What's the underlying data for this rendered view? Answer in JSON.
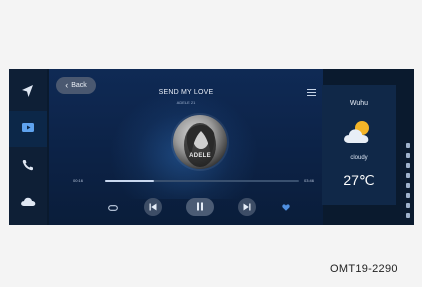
{
  "nav": {
    "back_label": "Back"
  },
  "sidebar": {
    "items": [
      {
        "icon": "navigation-arrow-icon"
      },
      {
        "icon": "media-icon"
      },
      {
        "icon": "phone-icon"
      },
      {
        "icon": "cloud-icon"
      }
    ]
  },
  "player": {
    "song_title": "SEND MY LOVE",
    "artist": "ADELE 21",
    "album_label": "ADELE",
    "elapsed": "00:16",
    "duration": "03:46",
    "progress_fraction": 0.25,
    "controls": {
      "repeat_icon": "repeat-icon",
      "prev_icon": "previous-track-icon",
      "play_icon": "pause-icon",
      "next_icon": "next-track-icon",
      "favorite_icon": "heart-icon"
    }
  },
  "weather": {
    "city": "Wuhu",
    "condition": "cloudy",
    "temperature": "27℃"
  },
  "caption": "OMT19-2290",
  "colors": {
    "screen_bg": "#0a1a2e",
    "accent": "#5a9be8",
    "heart": "#4f8fe0"
  }
}
